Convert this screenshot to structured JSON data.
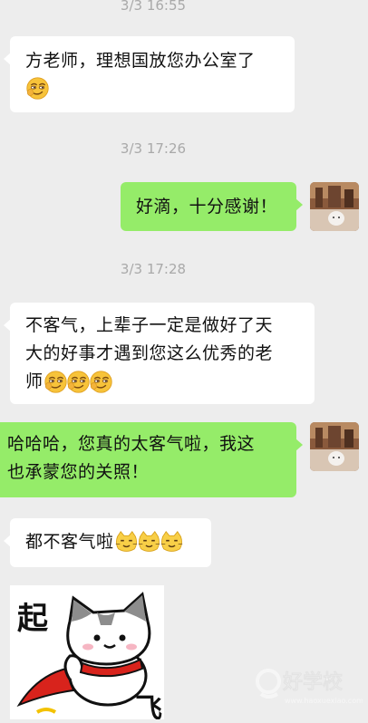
{
  "timestamps": [
    "3/3 16:55",
    "3/3 17:26",
    "3/3 17:28"
  ],
  "messages": [
    {
      "direction": "in",
      "line1": "方老师，理想国放您办公室了",
      "emojis": [
        "sly-face"
      ]
    },
    {
      "direction": "out",
      "text": "好滴，十分感谢！"
    },
    {
      "direction": "in",
      "line1": "不客气，上辈子一定是做好了天",
      "line2": "大的好事才遇到您这么优秀的老",
      "line3": "师",
      "emojis": [
        "sly-face",
        "sly-face",
        "sly-face"
      ]
    },
    {
      "direction": "out",
      "line1": "哈哈哈，您真的太客气啦，我这",
      "line2": "也承蒙您的关照！"
    },
    {
      "direction": "in",
      "text": "都不客气啦",
      "emojis": [
        "cat-face",
        "cat-face",
        "cat-face"
      ]
    },
    {
      "direction": "in",
      "sticker": "cat-flying-sticker",
      "sticker_text": "起 飞"
    }
  ],
  "sticker": {
    "top_char": "起",
    "bottom_char": "飞"
  },
  "watermark": {
    "brand": "好学校",
    "url": "www.haoxuexiao.com"
  },
  "colors": {
    "background": "#ededed",
    "incoming": "#ffffff",
    "outgoing": "#95ec69",
    "timestamp": "#a9a9a9"
  }
}
